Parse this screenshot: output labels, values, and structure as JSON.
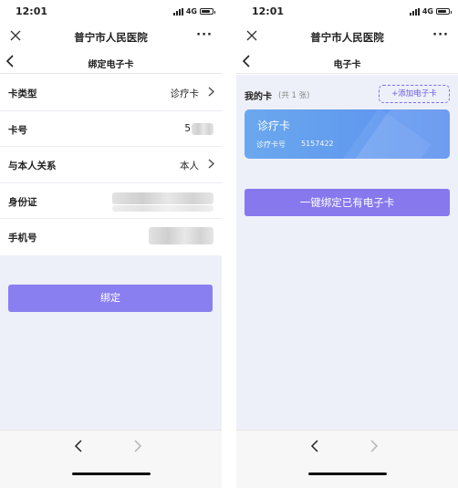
{
  "left_screen": {
    "status": {
      "time": "12:01",
      "network": "4G"
    },
    "app_title": "普宁市人民医院",
    "page_title": "绑定电子卡",
    "form": {
      "card_type": {
        "label": "卡类型",
        "value": "诊疗卡"
      },
      "card_number": {
        "label": "卡号",
        "value": "5"
      },
      "relationship": {
        "label": "与本人关系",
        "value": "本人"
      },
      "id_card": {
        "label": "身份证"
      },
      "phone": {
        "label": "手机号"
      }
    },
    "bind_button": "绑定"
  },
  "right_screen": {
    "status": {
      "time": "12:01",
      "network": "4G"
    },
    "app_title": "普宁市人民医院",
    "page_title": "电子卡",
    "my_cards_title": "我的卡",
    "my_cards_count": "(共 1 张)",
    "add_card_button": "+添加电子卡",
    "card": {
      "type": "诊疗卡",
      "number_label": "诊疗卡号",
      "number_value": "5157422"
    },
    "bind_existing_button": "一键绑定已有电子卡"
  },
  "colors": {
    "primary": "#8a7ff0",
    "card_gradient_start": "#6aa8ee",
    "card_gradient_end": "#5b8ff0",
    "page_bg": "#eef0f9"
  },
  "icons": [
    "close-icon",
    "more-icon",
    "back-chevron-icon",
    "chevron-right-icon",
    "signal-icon",
    "battery-icon",
    "browser-back-icon",
    "browser-forward-icon"
  ]
}
